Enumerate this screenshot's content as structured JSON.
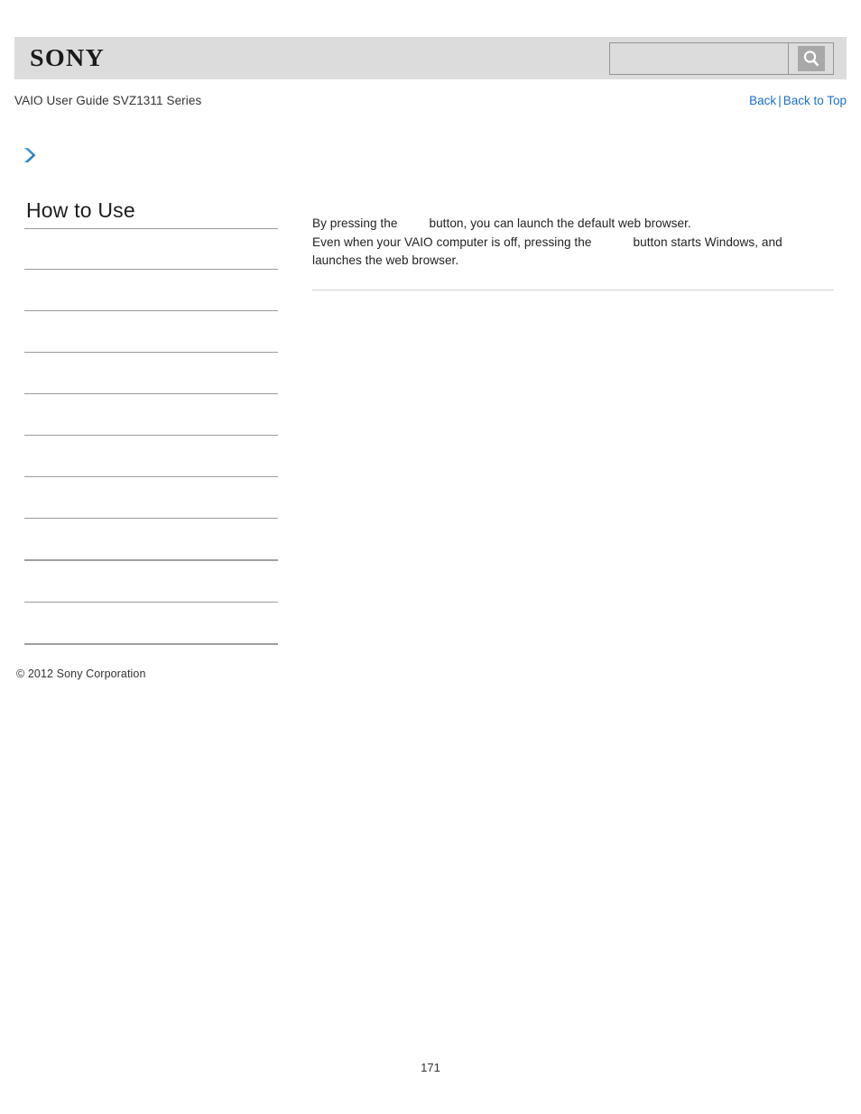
{
  "header": {
    "logo_text": "SONY",
    "search": {
      "value": "",
      "placeholder": "",
      "icon": "search-icon",
      "button_label": ""
    }
  },
  "breadcrumb": {
    "guide_title": "VAIO User Guide SVZ1311 Series",
    "back_label": "Back",
    "separator": "|",
    "back_to_top_label": "Back to Top"
  },
  "icons": {
    "expand_chevron": "chevron-right-icon"
  },
  "sidebar": {
    "title": "How to Use",
    "items": [
      {
        "label": ""
      },
      {
        "label": ""
      },
      {
        "label": ""
      },
      {
        "label": ""
      },
      {
        "label": ""
      },
      {
        "label": ""
      },
      {
        "label": ""
      },
      {
        "label": ""
      },
      {
        "label": ""
      },
      {
        "label": ""
      }
    ]
  },
  "main": {
    "paragraph_1_part_1": "By pressing the",
    "paragraph_1_part_2": "button, you can launch the default web browser.",
    "paragraph_2_part_1": "Even when your VAIO computer is off, pressing the",
    "paragraph_2_part_2": "button starts Windows, and",
    "paragraph_2_part_3": "launches the web browser."
  },
  "footer": {
    "copyright": "© 2012 Sony Corporation",
    "page_number": "171"
  },
  "colors": {
    "link": "#1a6fce",
    "header_bar": "#dcdcdc",
    "rule": "#9a9a9a",
    "chevron": "#1e7ac4"
  }
}
